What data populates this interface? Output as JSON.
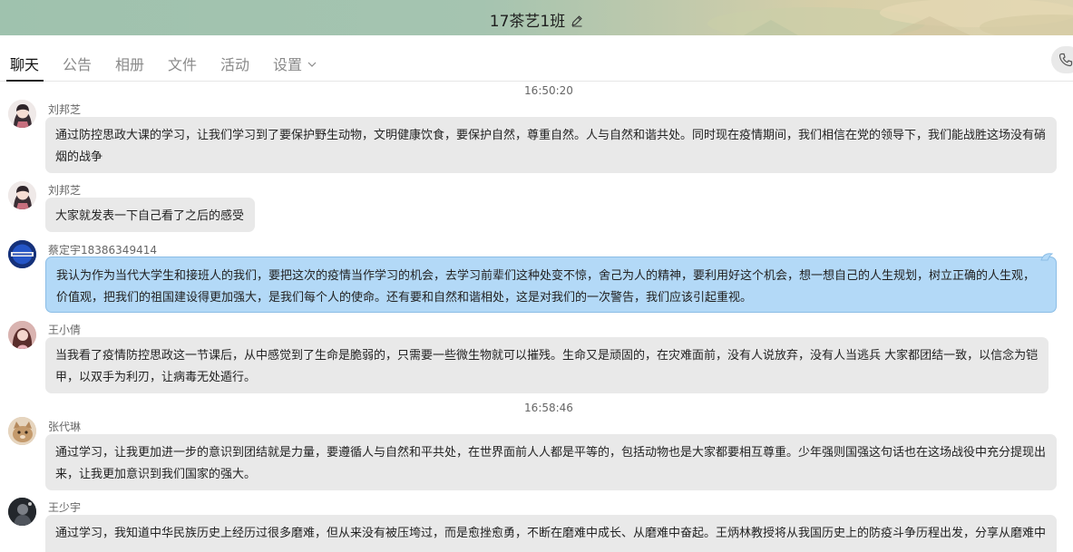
{
  "window": {
    "title": "17茶艺1班",
    "edit_icon": "pencil-icon"
  },
  "tabs": [
    {
      "label": "聊天",
      "active": true
    },
    {
      "label": "公告",
      "active": false
    },
    {
      "label": "相册",
      "active": false
    },
    {
      "label": "文件",
      "active": false
    },
    {
      "label": "活动",
      "active": false
    },
    {
      "label": "设置",
      "active": false,
      "icon": "chevron-down-icon"
    }
  ],
  "call_button": {
    "icon": "phone-icon"
  },
  "chat": {
    "timestamps": [
      "16:50:20",
      "16:58:46"
    ],
    "messages": [
      {
        "sender": "刘邦芝",
        "text": "通过防控思政大课的学习，让我们学习到了要保护野生动物，文明健康饮食，要保护自然，尊重自然。人与自然和谐共处。同时现在疫情期间，我们相信在党的领导下，我们能战胜这场没有硝烟的战争"
      },
      {
        "sender": "刘邦芝",
        "text": "大家就发表一下自己看了之后的感受"
      },
      {
        "sender": "蔡定宇18386349414",
        "text": "我认为作为当代大学生和接班人的我们，要把这次的疫情当作学习的机会，去学习前辈们这种处变不惊，舍己为人的精神，要利用好这个机会，想一想自己的人生规划，树立正确的人生观，价值观，把我们的祖国建设得更加强大，是我们每个人的使命。还有要和自然和谐相处，这是对我们的一次警告，我们应该引起重视。",
        "self": true
      },
      {
        "sender": "王小倩",
        "text": "当我看了疫情防控思政这一节课后，从中感觉到了生命是脆弱的，只需要一些微生物就可以摧残。生命又是顽固的，在灾难面前，没有人说放弃，没有人当逃兵 大家都团结一致，以信念为铠甲，以双手为利刃，让病毒无处遁行。"
      },
      {
        "sender": "张代琳",
        "text": "通过学习，让我更加进一步的意识到团结就是力量，要遵循人与自然和平共处，在世界面前人人都是平等的，包括动物也是大家都要相互尊重。少年强则国强这句话也在这场战役中充分提现出来，让我更加意识到我们国家的强大。"
      },
      {
        "sender": "王少宇",
        "text": "通过学习，我知道中华民族历史上经历过很多磨难，但从来没有被压垮过，而是愈挫愈勇，不断在磨难中成长、从磨难中奋起。王炳林教授将从我国历史上的防疫斗争历程出发，分享从磨难中"
      }
    ]
  },
  "colors": {
    "header_green": "#9fc2ae",
    "header_sand": "#ddd3b0",
    "bubble_other": "#e9e9e9",
    "bubble_self": "#b3d9f7",
    "bubble_self_border": "#8bbde6",
    "active_tab": "#111111",
    "inactive_tab": "#8a8a8a"
  },
  "avatars": [
    "avatar-anime-girl",
    "avatar-anime-girl",
    "avatar-blue-badge",
    "avatar-girl-photo",
    "avatar-cat-photo",
    "avatar-dark-figure"
  ]
}
